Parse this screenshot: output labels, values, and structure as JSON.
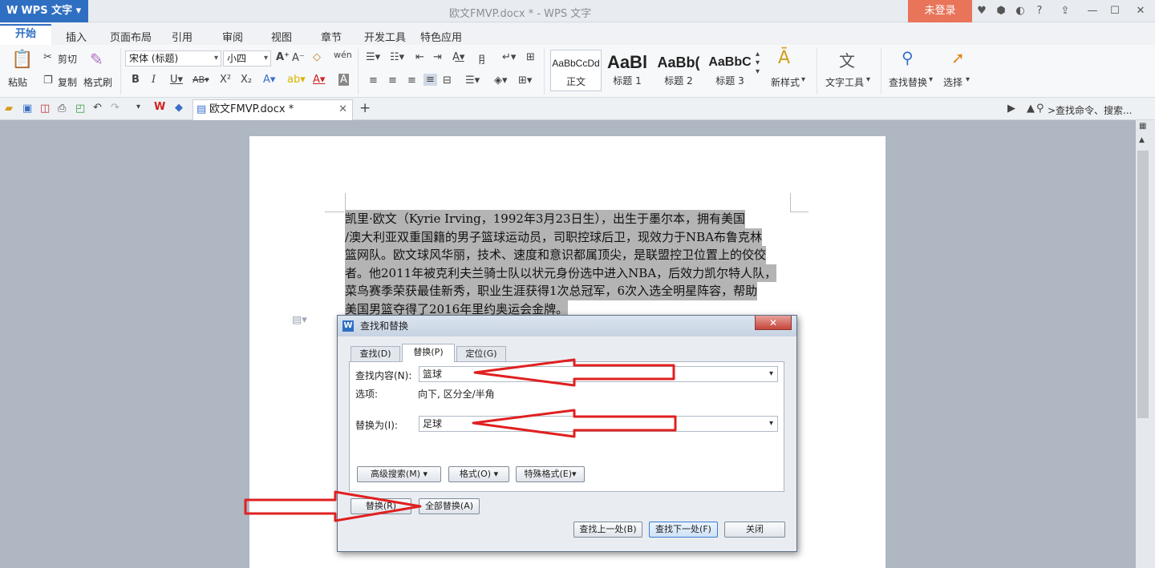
{
  "app": {
    "logo": "WPS 文字",
    "title": "欧文FMVP.docx * - WPS 文字",
    "login": "未登录"
  },
  "menu": [
    "开始",
    "插入",
    "页面布局",
    "引用",
    "审阅",
    "视图",
    "章节",
    "开发工具",
    "特色应用"
  ],
  "ribbon": {
    "paste": "粘贴",
    "cut": "剪切",
    "copy": "复制",
    "format_painter": "格式刷",
    "font_name": "宋体 (标题)",
    "font_size": "小四",
    "styles": [
      {
        "sample": "AaBbCcDd",
        "name": "正文"
      },
      {
        "sample": "AaBl",
        "name": "标题 1"
      },
      {
        "sample": "AaBb(",
        "name": "标题 2"
      },
      {
        "sample": "AaBbC",
        "name": "标题 3"
      }
    ],
    "new_style": "新样式",
    "text_tools": "文字工具",
    "find_replace": "查找替换",
    "select": "选择"
  },
  "tab": {
    "doc_name": "欧文FMVP.docx *",
    "search_cmd": ">查找命令、搜索..."
  },
  "document": {
    "lines": [
      "凯里·欧文（Kyrie Irving，1992年3月23日生），出生于墨尔本，拥有美国",
      "/澳大利亚双重国籍的男子篮球运动员，司职控球后卫，现效力于NBA布鲁克林",
      "篮网队。欧文球风华丽，技术、速度和意识都属顶尖，是联盟控卫位置上的佼佼",
      "者。他2011年被克利夫兰骑士队以状元身份选中进入NBA，后效力凯尔特人队，",
      "菜鸟赛季荣获最佳新秀，职业生涯获得1次总冠军，6次入选全明星阵容，帮助",
      "美国男篮夺得了2016年里约奥运会金牌。"
    ]
  },
  "dialog": {
    "title": "查找和替换",
    "tabs": [
      "查找(D)",
      "替换(P)",
      "定位(G)"
    ],
    "find_label": "查找内容(N):",
    "find_value": "篮球",
    "options_label": "选项:",
    "options_value": "向下, 区分全/半角",
    "replace_label": "替换为(I):",
    "replace_value": "足球",
    "advanced": "高级搜索(M)",
    "format": "格式(O)",
    "special": "特殊格式(E)",
    "replace_btn": "替换(R)",
    "replace_all_btn": "全部替换(A)",
    "find_prev": "查找上一处(B)",
    "find_next": "查找下一处(F)",
    "close": "关闭"
  },
  "colors": {
    "accent": "#2f6fc2",
    "login": "#e8745a",
    "arrow": "#e02020"
  }
}
